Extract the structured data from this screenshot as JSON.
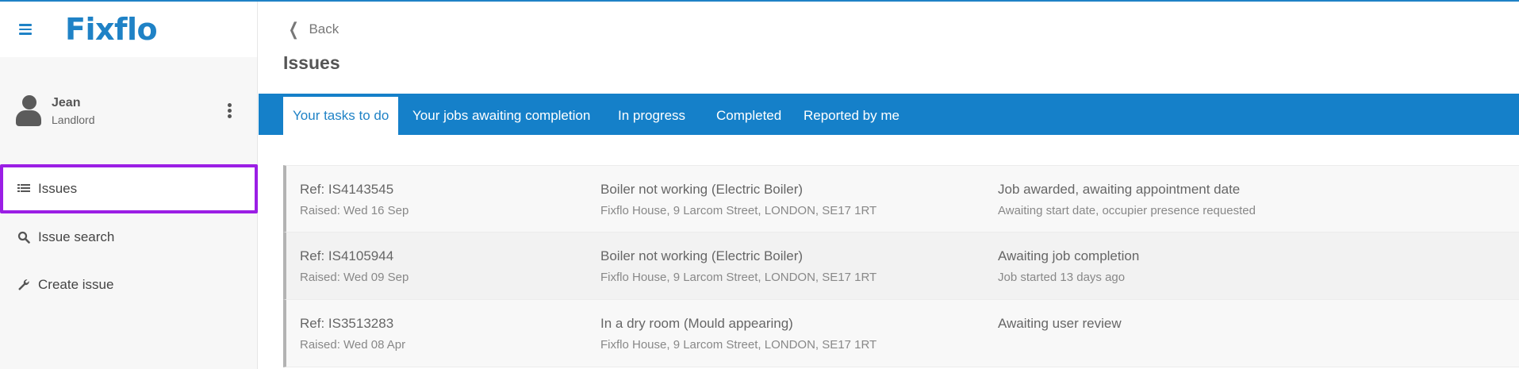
{
  "brand": {
    "name": "Fixflo",
    "color": "#1f82c6"
  },
  "user": {
    "name": "Jean",
    "role": "Landlord"
  },
  "sidebar": {
    "items": [
      {
        "label": "Issues",
        "icon": "list-icon",
        "active": true
      },
      {
        "label": "Issue search",
        "icon": "search-icon",
        "active": false
      },
      {
        "label": "Create issue",
        "icon": "wrench-icon",
        "active": false
      }
    ],
    "highlight_color": "#9b1ee5"
  },
  "header": {
    "back_label": "Back",
    "title": "Issues"
  },
  "tabs": [
    {
      "label": "Your tasks to do",
      "active": true
    },
    {
      "label": "Your jobs awaiting completion",
      "active": false
    },
    {
      "label": "In progress",
      "active": false
    },
    {
      "label": "Completed",
      "active": false
    },
    {
      "label": "Reported by me",
      "active": false
    }
  ],
  "issues": [
    {
      "ref": "Ref: IS4143545",
      "raised": "Raised: Wed 16 Sep",
      "title": "Boiler not working (Electric Boiler)",
      "address": "Fixflo House, 9 Larcom Street, LONDON, SE17 1RT",
      "status": "Job awarded, awaiting appointment date",
      "substatus": "Awaiting start date, occupier presence requested"
    },
    {
      "ref": "Ref: IS4105944",
      "raised": "Raised: Wed 09 Sep",
      "title": "Boiler not working (Electric Boiler)",
      "address": "Fixflo House, 9 Larcom Street, LONDON, SE17 1RT",
      "status": "Awaiting job completion",
      "substatus": "Job started 13 days ago"
    },
    {
      "ref": "Ref: IS3513283",
      "raised": "Raised: Wed 08 Apr",
      "title": "In a dry room (Mould appearing)",
      "address": "Fixflo House, 9 Larcom Street, LONDON, SE17 1RT",
      "status": "Awaiting user review",
      "substatus": ""
    }
  ],
  "colors": {
    "tabbar": "#1580c9",
    "accent": "#1f82c6"
  }
}
